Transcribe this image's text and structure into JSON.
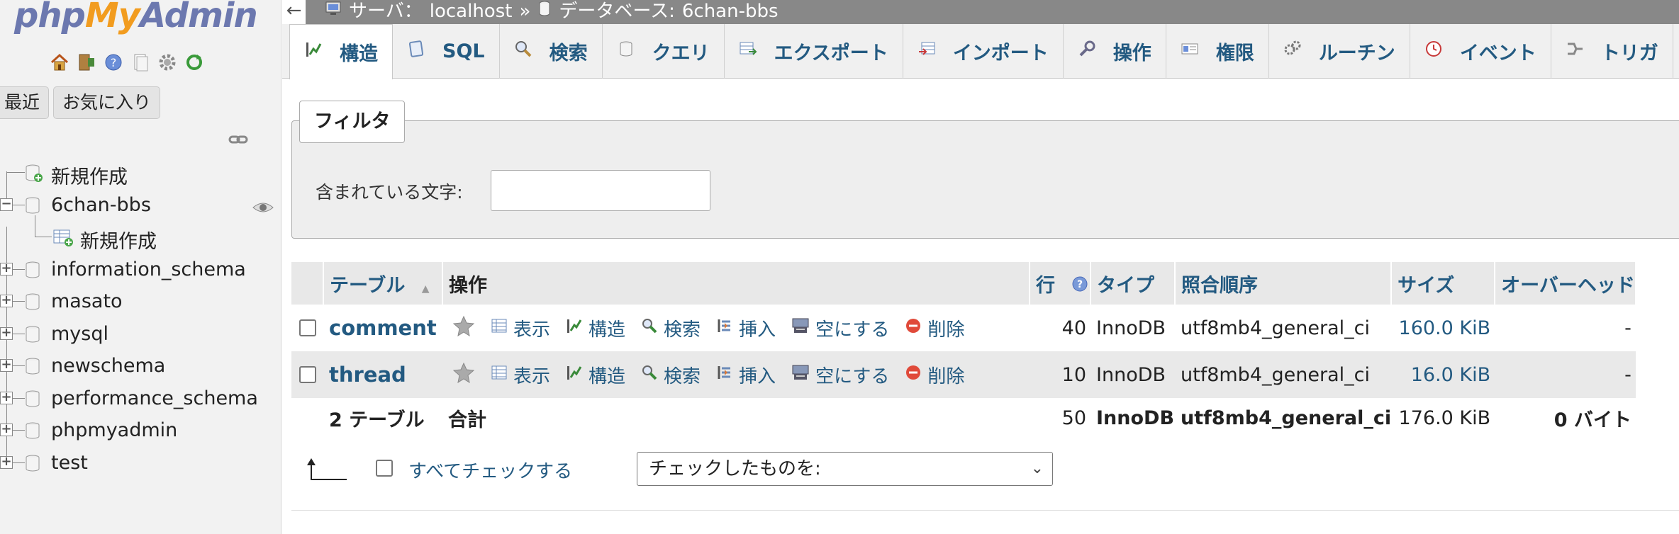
{
  "logo": {
    "php": "php",
    "my": "My",
    "admin": "Admin"
  },
  "nav_tabs": [
    "最近",
    "お気に入り"
  ],
  "tree": [
    {
      "label": "新規作成",
      "type": "new"
    },
    {
      "label": "6chan-bbs",
      "type": "db",
      "expanded": true
    },
    {
      "label": "新規作成",
      "type": "new-table"
    },
    {
      "label": "information_schema",
      "type": "db"
    },
    {
      "label": "masato",
      "type": "db"
    },
    {
      "label": "mysql",
      "type": "db"
    },
    {
      "label": "newschema",
      "type": "db"
    },
    {
      "label": "performance_schema",
      "type": "db"
    },
    {
      "label": "phpmyadmin",
      "type": "db"
    },
    {
      "label": "test",
      "type": "db"
    }
  ],
  "breadcrumb": {
    "back": "←",
    "server_label": "サーバ：",
    "server": "localhost",
    "sep": "»",
    "db_label": "データベース:",
    "db": "6chan-bbs"
  },
  "tabs": [
    {
      "label": "構造",
      "icon": "structure-icon",
      "active": true
    },
    {
      "label": "SQL",
      "icon": "sql-icon"
    },
    {
      "label": "検索",
      "icon": "search-icon"
    },
    {
      "label": "クエリ",
      "icon": "query-icon"
    },
    {
      "label": "エクスポート",
      "icon": "export-icon"
    },
    {
      "label": "インポート",
      "icon": "import-icon"
    },
    {
      "label": "操作",
      "icon": "wrench-icon"
    },
    {
      "label": "権限",
      "icon": "privileges-icon"
    },
    {
      "label": "ルーチン",
      "icon": "routines-icon"
    },
    {
      "label": "イベント",
      "icon": "events-icon"
    },
    {
      "label": "トリガ",
      "icon": "triggers-icon"
    }
  ],
  "filter": {
    "legend": "フィルタ",
    "label": "含まれている文字:",
    "value": ""
  },
  "table": {
    "headers": {
      "table": "テーブル",
      "sort": "▲",
      "actions": "操作",
      "rows": "行",
      "type": "タイプ",
      "collation": "照合順序",
      "size": "サイズ",
      "overhead": "オーバーヘッド"
    },
    "action_labels": [
      "表示",
      "構造",
      "検索",
      "挿入",
      "空にする",
      "削除"
    ],
    "rows": [
      {
        "name": "comment",
        "rows": "40",
        "type": "InnoDB",
        "collation": "utf8mb4_general_ci",
        "size": "160.0",
        "unit": "KiB",
        "overhead": "-"
      },
      {
        "name": "thread",
        "rows": "10",
        "type": "InnoDB",
        "collation": "utf8mb4_general_ci",
        "size": "16.0",
        "unit": "KiB",
        "overhead": "-"
      }
    ],
    "total": {
      "label": "2 テーブル",
      "sum_label": "合計",
      "rows": "50",
      "type": "InnoDB",
      "collation": "utf8mb4_general_ci",
      "size": "176.0 KiB",
      "overhead": "0 バイト"
    }
  },
  "bulk": {
    "check_all": "すべてチェックする",
    "select_placeholder": "チェックしたものを:"
  }
}
